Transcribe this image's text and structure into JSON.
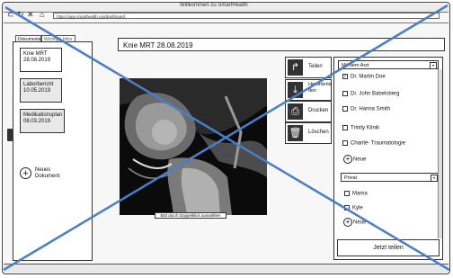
{
  "window": {
    "title": "Willkommen zu SmartHealth"
  },
  "address_bar": {
    "url": "https://app.smarthealth.org/dashboard"
  },
  "toolbar_icons": [
    "back-icon",
    "reload-icon",
    "close-icon",
    "home-icon"
  ],
  "tabs": [
    {
      "label": "Dokumente"
    },
    {
      "label": "Wichtige Infos"
    }
  ],
  "documents": [
    {
      "name": "Knie MRT",
      "date": "28.08.2019",
      "selected": true
    },
    {
      "name": "Laborbericht",
      "date": "10.05.2019",
      "selected": false
    },
    {
      "name": "Medikationsplan",
      "date": "08.03.2019",
      "selected": false
    }
  ],
  "new_document": {
    "line1": "Neues",
    "line2": "Dokument"
  },
  "document_title": "Knie MRT 28.08.2019",
  "image_caption": "Bild durch Doppelklick auswählen",
  "actions": [
    {
      "label": "Teilen",
      "icon": "share-icon"
    },
    {
      "label": "Herunterladen",
      "icon": "download-icon"
    },
    {
      "label": "Drucken",
      "icon": "print-icon"
    },
    {
      "label": "Löschen",
      "icon": "trash-icon"
    }
  ],
  "share": {
    "doctor_select": "Mit dem Arzt",
    "doctors": [
      {
        "label": "Dr. Martin Doe",
        "checked": true
      },
      {
        "label": "Dr. John Babelsberg",
        "checked": false
      },
      {
        "label": "Dr. Hanna Smith",
        "checked": false
      },
      {
        "label": "Trinity Klinik",
        "checked": false
      },
      {
        "label": "Charité- Traumatologie",
        "checked": false
      }
    ],
    "new_label_1": "Neue",
    "private_select": "Privat",
    "private": [
      {
        "label": "Mama",
        "checked": false
      },
      {
        "label": "Kyle",
        "checked": false
      }
    ],
    "new_label_2": "Neue",
    "submit": "Jetzt teilen"
  },
  "colors": {
    "cross": "#4a7fc8",
    "frame": "#333333"
  }
}
